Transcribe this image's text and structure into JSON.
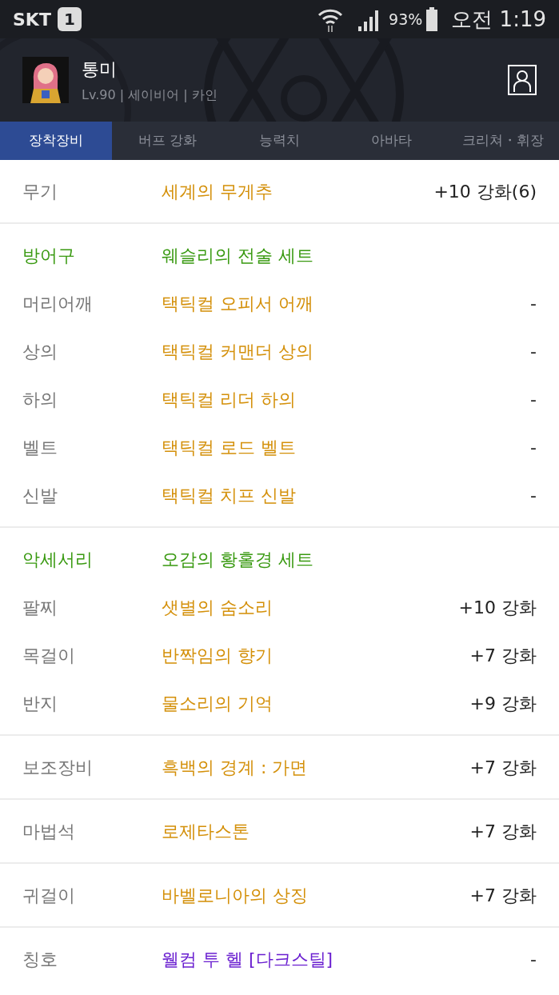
{
  "status_bar": {
    "carrier": "SKT",
    "sim": "1",
    "battery": "93%",
    "time": "오전 1:19"
  },
  "profile": {
    "name": "통미",
    "details": "Lv.90 | 세이비어 | 카인"
  },
  "tabs": [
    {
      "label": "장착장비",
      "selected": true
    },
    {
      "label": "버프 강화",
      "selected": false
    },
    {
      "label": "능력치",
      "selected": false
    },
    {
      "label": "아바타",
      "selected": false
    },
    {
      "label": "크리쳐・휘장",
      "selected": false
    }
  ],
  "sections": [
    {
      "rows": [
        {
          "kind": "item",
          "slot": "무기",
          "name": "세계의 무게추",
          "color": "#d4900a",
          "enhancement": "+10 강화(6)"
        }
      ]
    },
    {
      "rows": [
        {
          "kind": "set",
          "slot": "방어구",
          "name": "웨슬리의 전술 세트"
        },
        {
          "kind": "item",
          "slot": "머리어깨",
          "name": "택틱컬 오피서 어깨",
          "color": "#d4900a",
          "enhancement": "-"
        },
        {
          "kind": "item",
          "slot": "상의",
          "name": "택틱컬 커맨더 상의",
          "color": "#d4900a",
          "enhancement": "-"
        },
        {
          "kind": "item",
          "slot": "하의",
          "name": "택틱컬 리더 하의",
          "color": "#d4900a",
          "enhancement": "-"
        },
        {
          "kind": "item",
          "slot": "벨트",
          "name": "택틱컬 로드 벨트",
          "color": "#d4900a",
          "enhancement": "-"
        },
        {
          "kind": "item",
          "slot": "신발",
          "name": "택틱컬 치프 신발",
          "color": "#d4900a",
          "enhancement": "-"
        }
      ]
    },
    {
      "rows": [
        {
          "kind": "set",
          "slot": "악세서리",
          "name": "오감의 황홀경 세트"
        },
        {
          "kind": "item",
          "slot": "팔찌",
          "name": "샛별의 숨소리",
          "color": "#d4900a",
          "enhancement": "+10 강화"
        },
        {
          "kind": "item",
          "slot": "목걸이",
          "name": "반짝임의 향기",
          "color": "#d4900a",
          "enhancement": "+7 강화"
        },
        {
          "kind": "item",
          "slot": "반지",
          "name": "물소리의 기억",
          "color": "#d4900a",
          "enhancement": "+9 강화"
        }
      ]
    },
    {
      "rows": [
        {
          "kind": "item",
          "slot": "보조장비",
          "name": "흑백의 경계 : 가면",
          "color": "#d4900a",
          "enhancement": "+7 강화"
        }
      ]
    },
    {
      "rows": [
        {
          "kind": "item",
          "slot": "마법석",
          "name": "로제타스톤",
          "color": "#d4900a",
          "enhancement": "+7 강화"
        }
      ]
    },
    {
      "rows": [
        {
          "kind": "item",
          "slot": "귀걸이",
          "name": "바벨로니아의 상징",
          "color": "#d4900a",
          "enhancement": "+7 강화"
        }
      ]
    },
    {
      "rows": [
        {
          "kind": "item",
          "slot": "칭호",
          "name": "웰컴 투 헬 [다크스틸]",
          "color": "#6a1fd0",
          "enhancement": "-"
        }
      ]
    }
  ]
}
